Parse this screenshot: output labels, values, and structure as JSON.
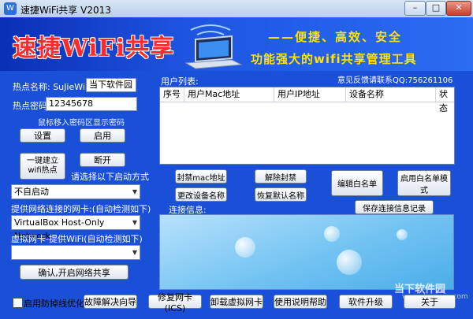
{
  "window": {
    "title": "速捷WiFi共享 V2013",
    "controls": [
      "–",
      "□",
      "✕"
    ]
  },
  "banner": {
    "brand": "速捷WiFi共享",
    "slogan1": "——便捷、高效、安全",
    "slogan2": "功能强大的wifi共享管理工具"
  },
  "left": {
    "hotspot_name_label": "热点名称: SuJieWiFi-",
    "hotspot_name_value": "当下软件园",
    "hotspot_pwd_label": "热点密码:",
    "hotspot_pwd_value": "12345678",
    "hint": "鼠标移入密码区显示密码",
    "btn_settings": "设置",
    "btn_enable": "启用",
    "btn_one_click": "一键建立\nwifi热点",
    "btn_disconnect": "断开",
    "startup_label": "请选择以下启动方式",
    "startup_value": "不自启动",
    "net_card_label": "提供网络连接的网卡:(自动检测如下)",
    "net_card_value": "VirtualBox Host-Only Network",
    "virtual_card_label": "虚拟网卡-提供WiFi(自动检测如下)",
    "virtual_card_value": "",
    "btn_confirm_share": "确认,开启网络共享"
  },
  "users": {
    "list_title": "用户列表:",
    "feedback": "意见反馈请联系QQ:756261106",
    "columns": [
      "序号",
      "用户Mac地址",
      "用户IP地址",
      "设备名称",
      "状态"
    ]
  },
  "actions": {
    "block_mac": "封禁mac地址",
    "unblock": "解除封禁",
    "edit_whitelist": "编辑白名单",
    "enable_whitelist": "启用白名单模式",
    "rename_device": "更改设备名称",
    "restore_name": "恢复默认名称",
    "save_conn_info": "保存连接信息记录",
    "conn_info_label": "连接信息:"
  },
  "bottom": {
    "anti_drop": "启用防掉线优化",
    "fault_wizard": "故障解决向导",
    "repair_nic": "修复网卡(ICS)",
    "uninstall_vnic": "卸载虚拟网卡",
    "help": "使用说明帮助",
    "upgrade": "软件升级",
    "about": "关于"
  },
  "watermark": {
    "text": "当下软件园",
    "sub": "www.downxia.com"
  },
  "colors": {
    "window_bg": "#1a4fd8",
    "brand": "#ff2a2a",
    "slogan": "#ffe400"
  }
}
